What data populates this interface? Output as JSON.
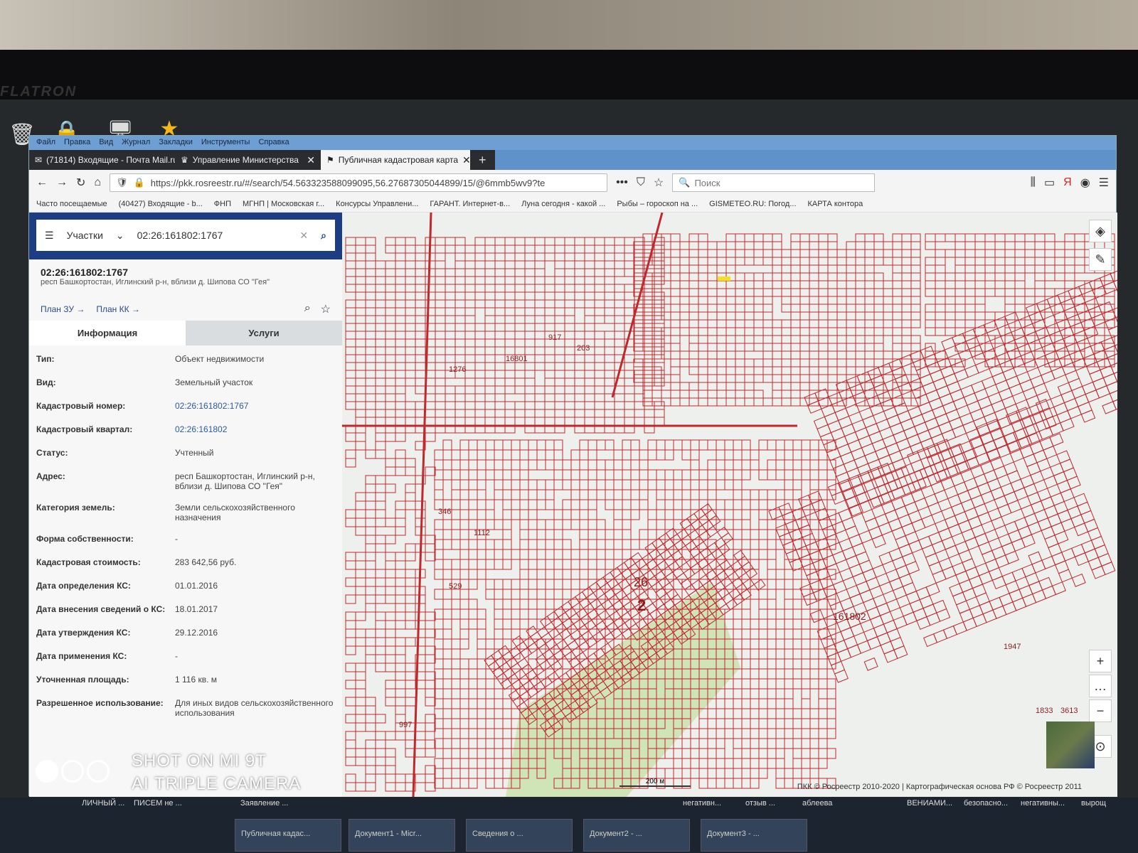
{
  "monitor": {
    "brand": "FLATRON"
  },
  "menu": [
    "Файл",
    "Правка",
    "Вид",
    "Журнал",
    "Закладки",
    "Инструменты",
    "Справка"
  ],
  "tabs": [
    {
      "label": "(71814) Входящие - Почта Mail.ru"
    },
    {
      "label": "Управление Министерства"
    },
    {
      "label": "Публичная кадастровая карта",
      "active": true
    }
  ],
  "nav": {
    "url": "https://pkk.rosreestr.ru/#/search/54.563323588099095,56.27687305044899/15/@6mmb5wv9?te",
    "search_placeholder": "Поиск"
  },
  "bookmarks": [
    "Часто посещаемые",
    "(40427) Входящие - b...",
    "ФНП",
    "МГНП | Московская г...",
    "Консурсы Управлени...",
    "ГАРАНТ. Интернет-в...",
    "Луна сегодня - какой ...",
    "Рыбы – гороскоп на ...",
    "GISMETEO.RU: Погод...",
    "КАРТА контора"
  ],
  "sidebar": {
    "search_type": "Участки",
    "query": "02:26:161802:1767",
    "title": "02:26:161802:1767",
    "address": "респ Башкортостан, Иглинский р-н, вблизи д. Шипова СО \"Гея\"",
    "plan_zu": "План ЗУ →",
    "plan_kk": "План КК →",
    "tab_info": "Информация",
    "tab_services": "Услуги",
    "rows": [
      {
        "k": "Тип:",
        "v": "Объект недвижимости"
      },
      {
        "k": "Вид:",
        "v": "Земельный участок"
      },
      {
        "k": "Кадастровый номер:",
        "v": "02:26:161802:1767",
        "link": true
      },
      {
        "k": "Кадастровый квартал:",
        "v": "02:26:161802",
        "link": true
      },
      {
        "k": "Статус:",
        "v": "Учтенный"
      },
      {
        "k": "Адрес:",
        "v": "респ Башкортостан, Иглинский р-н, вблизи д. Шипова СО \"Гея\""
      },
      {
        "k": "Категория земель:",
        "v": "Земли сельскохозяйственного назначения"
      },
      {
        "k": "Форма собственности:",
        "v": "-"
      },
      {
        "k": "Кадастровая стоимость:",
        "v": "283 642,56 руб."
      },
      {
        "k": "Дата определения КС:",
        "v": "01.01.2016"
      },
      {
        "k": "Дата внесения сведений о КС:",
        "v": "18.01.2017"
      },
      {
        "k": "Дата утверждения КС:",
        "v": "29.12.2016"
      },
      {
        "k": "Дата применения КС:",
        "v": "-"
      },
      {
        "k": "Уточненная площадь:",
        "v": "1 116 кв. м"
      },
      {
        "k": "Разрешенное использование:",
        "v": "Для иных видов сельскохозяйственного использования"
      }
    ]
  },
  "map": {
    "labels": [
      "16801",
      "161802",
      "917",
      "203",
      "1276",
      "1947",
      "26",
      "2",
      "997",
      "346",
      "1112",
      "529",
      "1833",
      "3613"
    ],
    "scale": "200 м",
    "copyright": "ПКК © Росреестр 2010-2020 | Картографическая основа РФ © Росреестр 2011",
    "parcel_color": "#c0282d"
  },
  "taskbar": [
    "ЛИЧНЫЙ ...",
    "ПИСЕМ не ...",
    "Заявление ...",
    "негативн...",
    "отзыв ...",
    "аблеева",
    "ВЕНИАМИ...",
    "безопасно...",
    "негативны...",
    "вырощ"
  ],
  "taskbar_buttons": [
    "Публичная кадас...",
    "Документ1 - Micr...",
    "Сведения о ...",
    "Документ2 - ...",
    "Документ3 - ..."
  ],
  "watermark": {
    "line1": "SHOT ON MI 9T",
    "line2": "AI TRIPLE CAMERA"
  }
}
